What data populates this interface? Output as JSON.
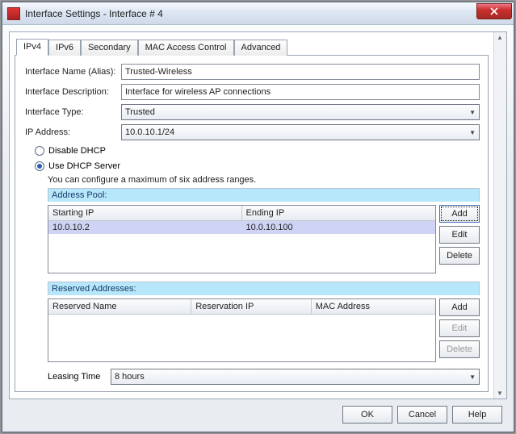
{
  "title": "Interface Settings - Interface # 4",
  "tabs": [
    "IPv4",
    "IPv6",
    "Secondary",
    "MAC Access Control",
    "Advanced"
  ],
  "activeTab": 0,
  "form": {
    "nameLabel": "Interface Name (Alias):",
    "nameValue": "Trusted-Wireless",
    "descLabel": "Interface Description:",
    "descValue": "Interface for wireless AP connections",
    "typeLabel": "Interface Type:",
    "typeValue": "Trusted",
    "ipLabel": "IP Address:",
    "ipValue": "10.0.10.1/24"
  },
  "dhcp": {
    "disableLabel": "Disable DHCP",
    "useServerLabel": "Use DHCP Server",
    "selected": "server",
    "hint": "You can configure a maximum of six address ranges.",
    "pool": {
      "title": "Address Pool:",
      "headers": [
        "Starting IP",
        "Ending IP"
      ],
      "rows": [
        {
          "start": "10.0.10.2",
          "end": "10.0.10.100"
        }
      ],
      "buttons": {
        "add": "Add",
        "edit": "Edit",
        "delete": "Delete"
      }
    },
    "reserved": {
      "title": "Reserved Addresses:",
      "headers": [
        "Reserved Name",
        "Reservation IP",
        "MAC Address"
      ],
      "rows": [],
      "buttons": {
        "add": "Add",
        "edit": "Edit",
        "delete": "Delete"
      }
    },
    "leasing": {
      "label": "Leasing Time",
      "value": "8 hours"
    }
  },
  "footer": {
    "ok": "OK",
    "cancel": "Cancel",
    "help": "Help"
  }
}
